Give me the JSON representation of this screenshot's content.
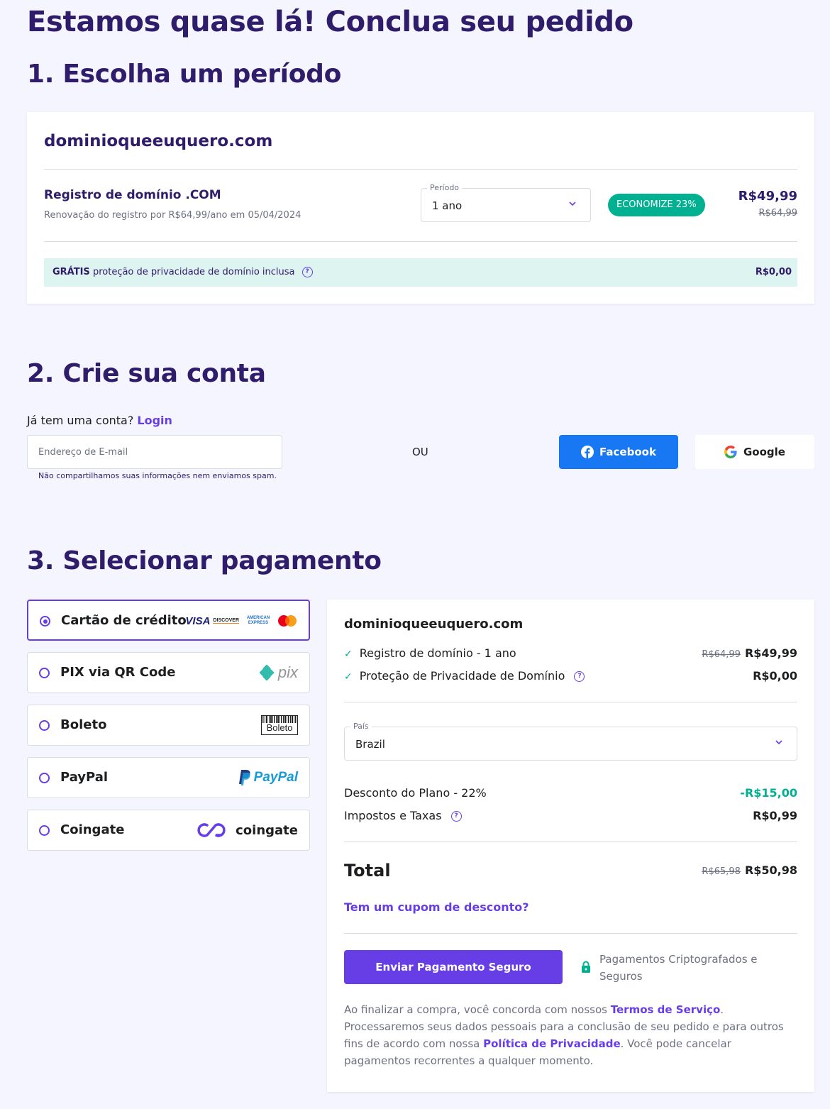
{
  "page_title": "Estamos quase lá! Conclua seu pedido",
  "steps": {
    "step1": "1. Escolha um período",
    "step2": "2. Crie sua conta",
    "step3": "3. Selecionar pagamento"
  },
  "period_card": {
    "domain": "dominioqueeuquero.com",
    "item_title": "Registro de domínio .COM",
    "renewal_text": "Renovação do registro por R$64,99/ano em 05/04/2024",
    "period_label": "Período",
    "period_value": "1 ano",
    "badge": "ECONOMIZE 23%",
    "price": "R$49,99",
    "price_old": "R$64,99",
    "privacy_free": "GRÁTIS",
    "privacy_text": "proteção de privacidade de domínio inclusa",
    "privacy_price": "R$0,00"
  },
  "account": {
    "has_account": "Já tem uma conta?",
    "login": "Login",
    "email_placeholder": "Endereço de E-mail",
    "email_note": "Não compartilhamos suas informações nem enviamos spam.",
    "or": "OU",
    "facebook": "Facebook",
    "google": "Google"
  },
  "payment": {
    "options": [
      {
        "label": "Cartão de crédito",
        "selected": true
      },
      {
        "label": "PIX via QR Code",
        "selected": false
      },
      {
        "label": "Boleto",
        "selected": false
      },
      {
        "label": "PayPal",
        "selected": false
      },
      {
        "label": "Coingate",
        "selected": false
      }
    ],
    "logos": {
      "visa": "VISA",
      "discover": "DISCOVER",
      "amex": "AMERICAN EXPRESS",
      "pix": "pix",
      "boleto": "Boleto",
      "paypal": "PayPal",
      "coingate": "coingate"
    }
  },
  "summary": {
    "domain": "dominioqueeuquero.com",
    "items": [
      {
        "label": "Registro de domínio - 1 ano",
        "old": "R$64,99",
        "price": "R$49,99"
      },
      {
        "label": "Proteção de Privacidade de Domínio",
        "old": "",
        "price": "R$0,00"
      }
    ],
    "country_label": "País",
    "country_value": "Brazil",
    "discount_label": "Desconto do Plano - 22%",
    "discount_value": "-R$15,00",
    "taxes_label": "Impostos e Taxas",
    "taxes_value": "R$0,99",
    "total_label": "Total",
    "total_old": "R$65,98",
    "total_value": "R$50,98",
    "coupon": "Tem um cupom de desconto?",
    "submit": "Enviar Pagamento Seguro",
    "secure_note": "Pagamentos Criptografados e Seguros",
    "legal_1": "Ao finalizar a compra, você concorda com nossos ",
    "legal_terms": "Termos de Serviço",
    "legal_2": ". Processaremos seus dados pessoais para a conclusão de seu pedido e para outros fins de acordo com nossa ",
    "legal_privacy": "Política de Privacidade",
    "legal_3": ". Você pode cancelar pagamentos recorrentes a qualquer momento."
  },
  "colors": {
    "primary": "#673de6",
    "heading": "#2f1c6a",
    "success": "#00b090",
    "facebook": "#1877f2",
    "background": "#f4f5ff"
  }
}
